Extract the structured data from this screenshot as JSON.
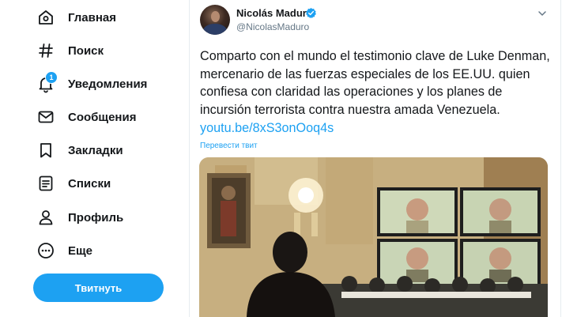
{
  "nav": {
    "items": [
      {
        "label": "Главная",
        "icon": "home-icon"
      },
      {
        "label": "Поиск",
        "icon": "hashtag-icon"
      },
      {
        "label": "Уведомления",
        "icon": "bell-icon",
        "badge": "1"
      },
      {
        "label": "Сообщения",
        "icon": "envelope-icon"
      },
      {
        "label": "Закладки",
        "icon": "bookmark-icon"
      },
      {
        "label": "Списки",
        "icon": "list-icon"
      },
      {
        "label": "Профиль",
        "icon": "user-icon"
      },
      {
        "label": "Еще",
        "icon": "more-icon"
      }
    ],
    "tweet_button": "Твитнуть"
  },
  "tweet": {
    "author_name": "Nicolás Maduro",
    "handle": "@NicolasMaduro",
    "text": "Comparto con el mundo el testimonio clave de Luke Denman, mercenario de las fuerzas especiales de los EE.UU. quien confiesa con claridad las operaciones y los planes de incursión terrorista contra nuestra amada Venezuela.",
    "link": "youtu.be/8xS3onOoq4s",
    "translate": "Перевести твит",
    "media": "press-conference-photo"
  },
  "colors": {
    "accent": "#1da1f2",
    "text": "#14171a",
    "secondary": "#657786",
    "border": "#e6ecf0"
  }
}
